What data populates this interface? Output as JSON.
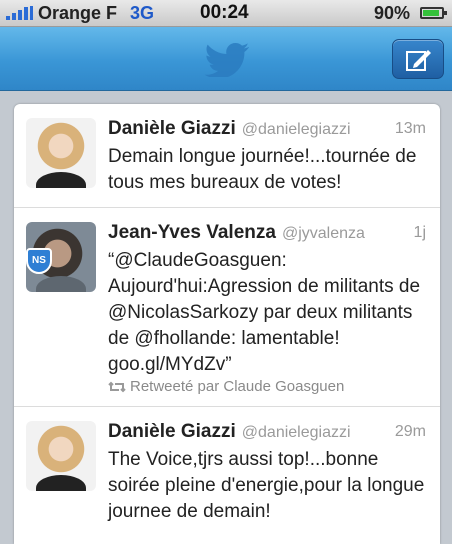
{
  "status_bar": {
    "carrier": "Orange F",
    "network": "3G",
    "time": "00:24",
    "battery": "90%",
    "battery_level": 0.9
  },
  "nav_bar": {
    "logo_icon": "twitter-bird-icon",
    "compose_icon": "compose-icon"
  },
  "tweets": [
    {
      "name": "Danièle Giazzi",
      "handle": "@danielegiazzi",
      "time": "13m",
      "text": "Demain longue journée!...tournée de tous mes bureaux de votes!",
      "avatar_icon": "user-photo"
    },
    {
      "name": "Jean-Yves Valenza",
      "handle": "@jyvalenza",
      "time": "1j",
      "text": "“@ClaudeGoasguen: Aujourd'hui:Agression de militants de @NicolasSarkozy par deux militants de @fhollande: lamentable! goo.gl/MYdZv”",
      "badge": "NS",
      "retweet": "Retweeté par Claude Goasguen",
      "avatar_icon": "user-photo"
    },
    {
      "name": "Danièle Giazzi",
      "handle": "@danielegiazzi",
      "time": "29m",
      "text": "The Voice,tjrs aussi top!...bonne soirée pleine d'energie,pour la longue journee de demain!",
      "avatar_icon": "user-photo"
    }
  ],
  "colors": {
    "nav_blue": "#3a96d6",
    "signal_blue": "#2a6bd6",
    "battery_green": "#34c13a"
  }
}
